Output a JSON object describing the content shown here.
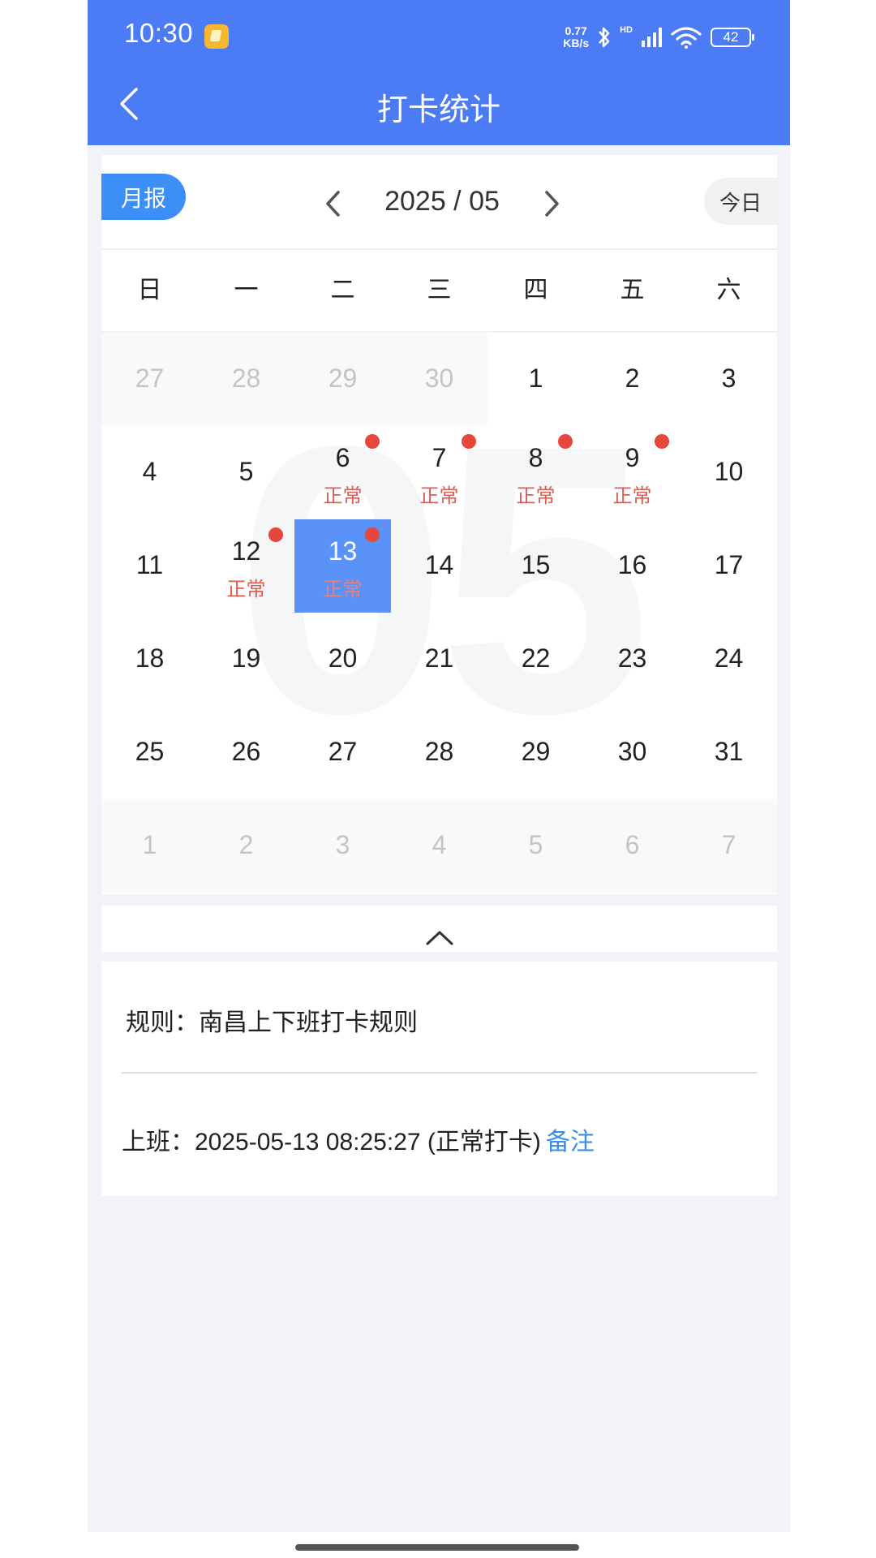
{
  "status_bar": {
    "time": "10:30",
    "net_speed_value": "0.77",
    "net_speed_unit": "KB/s",
    "network_label": "HD",
    "battery": "42",
    "icons": [
      "app-notification-icon",
      "bluetooth-icon",
      "signal-icon",
      "wifi-icon",
      "battery-icon"
    ]
  },
  "header": {
    "title": "打卡统计",
    "back_icon": "chevron-left-icon"
  },
  "toolbar": {
    "month_report_label": "月报",
    "current_month": "2025 / 05",
    "today_label": "今日"
  },
  "weekdays": [
    "日",
    "一",
    "二",
    "三",
    "四",
    "五",
    "六"
  ],
  "watermark": "05",
  "calendar": {
    "weeks": [
      [
        {
          "day": "27",
          "other": true
        },
        {
          "day": "28",
          "other": true
        },
        {
          "day": "29",
          "other": true
        },
        {
          "day": "30",
          "other": true
        },
        {
          "day": "1"
        },
        {
          "day": "2"
        },
        {
          "day": "3"
        }
      ],
      [
        {
          "day": "4"
        },
        {
          "day": "5"
        },
        {
          "day": "6",
          "status": "正常",
          "dot": true
        },
        {
          "day": "7",
          "status": "正常",
          "dot": true
        },
        {
          "day": "8",
          "status": "正常",
          "dot": true
        },
        {
          "day": "9",
          "status": "正常",
          "dot": true
        },
        {
          "day": "10"
        }
      ],
      [
        {
          "day": "11"
        },
        {
          "day": "12",
          "status": "正常",
          "dot": true
        },
        {
          "day": "13",
          "status": "正常",
          "dot": true,
          "selected": true
        },
        {
          "day": "14"
        },
        {
          "day": "15"
        },
        {
          "day": "16"
        },
        {
          "day": "17"
        }
      ],
      [
        {
          "day": "18"
        },
        {
          "day": "19"
        },
        {
          "day": "20"
        },
        {
          "day": "21"
        },
        {
          "day": "22"
        },
        {
          "day": "23"
        },
        {
          "day": "24"
        }
      ],
      [
        {
          "day": "25"
        },
        {
          "day": "26"
        },
        {
          "day": "27"
        },
        {
          "day": "28"
        },
        {
          "day": "29"
        },
        {
          "day": "30"
        },
        {
          "day": "31"
        }
      ],
      [
        {
          "day": "1",
          "other": true
        },
        {
          "day": "2",
          "other": true
        },
        {
          "day": "3",
          "other": true
        },
        {
          "day": "4",
          "other": true
        },
        {
          "day": "5",
          "other": true
        },
        {
          "day": "6",
          "other": true
        },
        {
          "day": "7",
          "other": true
        }
      ]
    ]
  },
  "details": {
    "rule_label": "规则：",
    "rule_value": "南昌上下班打卡规则",
    "punch_label": "上班：",
    "punch_value": "2025-05-13 08:25:27 (正常打卡)",
    "note_label": "备注"
  },
  "colors": {
    "header_bg": "#4b7bf5",
    "accent": "#3d8ff8",
    "selected_day": "#5b92f8",
    "status_red": "#e05a4f",
    "link_blue": "#3a8ee6"
  }
}
